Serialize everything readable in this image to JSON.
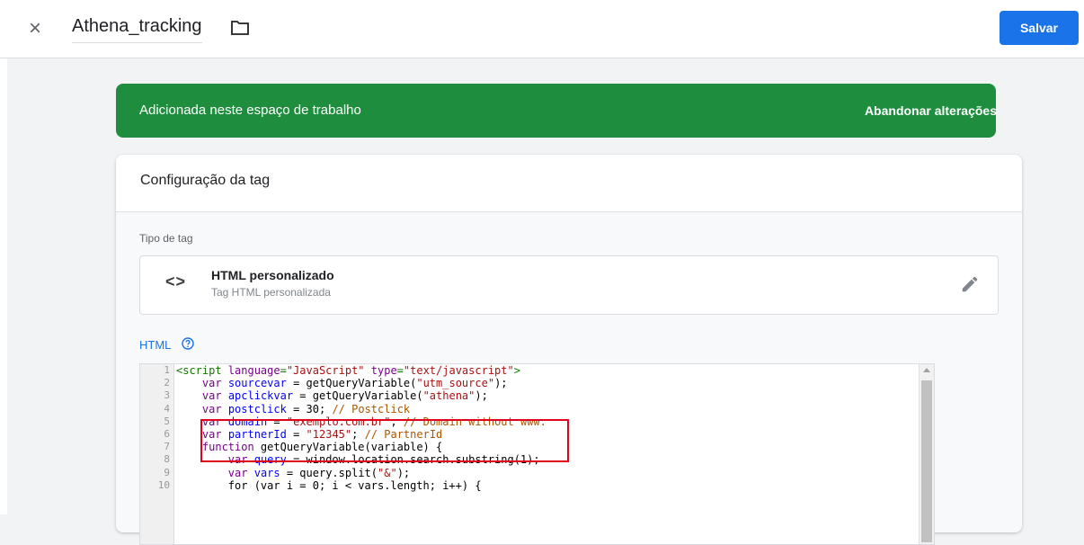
{
  "header": {
    "close_icon": "×",
    "title": "Athena_tracking",
    "save_label": "Salvar"
  },
  "banner": {
    "text": "Adicionada neste espaço de trabalho",
    "discard_label": "Abandonar alterações",
    "color": "#1e8e3e"
  },
  "card": {
    "title": "Configuração da tag",
    "type_label": "Tipo de tag",
    "type_icon": "<>",
    "type_name": "HTML personalizado",
    "type_sub": "Tag HTML personalizada",
    "html_label": "HTML"
  },
  "editor": {
    "line_numbers": [
      "1",
      "2",
      "3",
      "4",
      "5",
      "6",
      "7",
      "8",
      "9",
      "10"
    ],
    "lines": [
      [
        [
          "tag",
          "<script "
        ],
        [
          "kw",
          "language"
        ],
        [
          "tag",
          "="
        ],
        [
          "str",
          "\"JavaScript\""
        ],
        [
          "tag",
          " "
        ],
        [
          "kw",
          "type"
        ],
        [
          "tag",
          "="
        ],
        [
          "str",
          "\"text/javascript\""
        ],
        [
          "tag",
          ">"
        ]
      ],
      [
        [
          "",
          "    "
        ],
        [
          "kw",
          "var"
        ],
        [
          "",
          " "
        ],
        [
          "var",
          "sourcevar"
        ],
        [
          "",
          " = getQueryVariable("
        ],
        [
          "str",
          "\"utm_source\""
        ],
        [
          "",
          ");"
        ]
      ],
      [
        [
          "",
          "    "
        ],
        [
          "kw",
          "var"
        ],
        [
          "",
          " "
        ],
        [
          "var",
          "apclickvar"
        ],
        [
          "",
          " = getQueryVariable("
        ],
        [
          "str",
          "\"athena\""
        ],
        [
          "",
          ");"
        ]
      ],
      [
        [
          "",
          "    "
        ],
        [
          "kw",
          "var"
        ],
        [
          "",
          " "
        ],
        [
          "var",
          "postclick"
        ],
        [
          "",
          " = "
        ],
        [
          "",
          "30"
        ],
        [
          "",
          "; "
        ],
        [
          "com",
          "// Postclick"
        ]
      ],
      [
        [
          "",
          "    "
        ],
        [
          "kw",
          "var"
        ],
        [
          "",
          " "
        ],
        [
          "var",
          "domain"
        ],
        [
          "",
          " = "
        ],
        [
          "str",
          "\"exemplo.com.br\""
        ],
        [
          "",
          "; "
        ],
        [
          "com",
          "// Domain without www."
        ]
      ],
      [
        [
          "",
          "    "
        ],
        [
          "kw",
          "var"
        ],
        [
          "",
          " "
        ],
        [
          "var",
          "partnerId"
        ],
        [
          "",
          " = "
        ],
        [
          "str",
          "\"12345\""
        ],
        [
          "",
          "; "
        ],
        [
          "com",
          "// PartnerId"
        ]
      ],
      [
        [
          "",
          "    "
        ],
        [
          "kw",
          "function"
        ],
        [
          "",
          " getQueryVariable(variable) {"
        ]
      ],
      [
        [
          "",
          "        "
        ],
        [
          "kw",
          "var"
        ],
        [
          "",
          " "
        ],
        [
          "var",
          "query"
        ],
        [
          "",
          " = window.location.search.substring(1);"
        ]
      ],
      [
        [
          "",
          "        "
        ],
        [
          "kw",
          "var"
        ],
        [
          "",
          " "
        ],
        [
          "var",
          "vars"
        ],
        [
          "",
          " = query.split("
        ],
        [
          "str",
          "\"&\""
        ],
        [
          "",
          ");"
        ]
      ],
      [
        [
          "",
          "        for (var i = 0; i < vars.length; i++) {"
        ]
      ]
    ]
  }
}
